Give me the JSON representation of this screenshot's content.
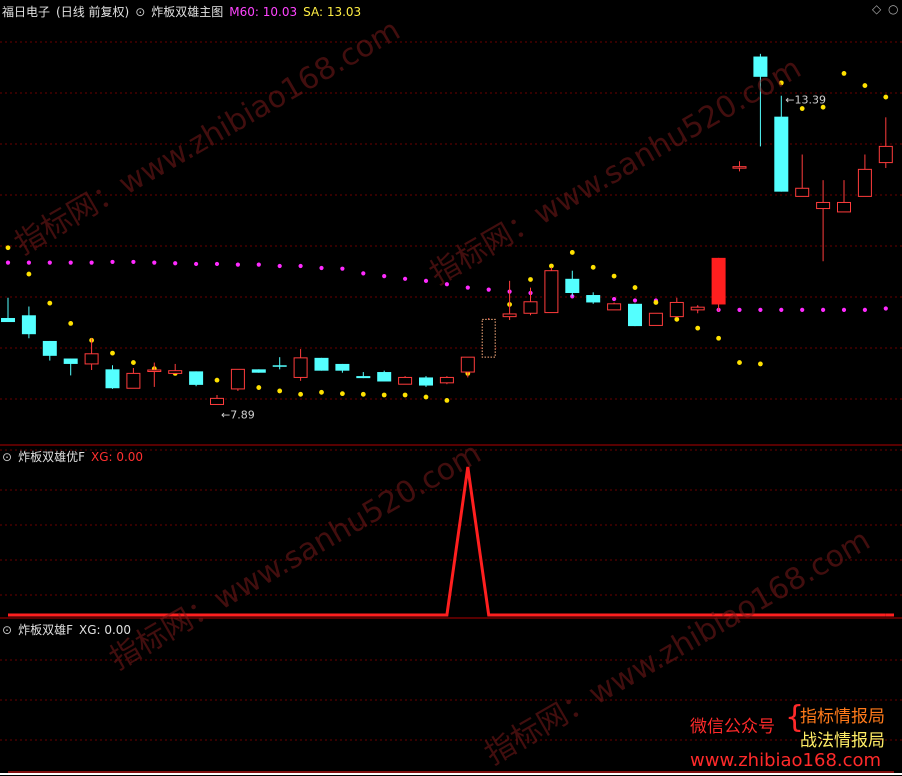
{
  "app": {
    "stock_title": "福日电子",
    "period_label": "(日线 前复权)",
    "indicator_main": "炸板双雄主图",
    "m60_label": "M60: 10.03",
    "sa_label": "SA: 13.03",
    "sub1_title": "炸板双雄优F",
    "sub1_value": "XG: 0.00",
    "sub2_title": "炸板双雄F",
    "sub2_value": "XG: 0.00"
  },
  "icons": {
    "collapse": "circle-chevron-down-icon",
    "panel_toggle": "diamond-icon"
  },
  "colors": {
    "up": "#ff3c3c",
    "down": "#54ffff",
    "m60": "#ff2bff",
    "sa": "#ffe100",
    "signal": "#ff1f1f",
    "grid": "#6a0000",
    "m60_label": "#ff44ff",
    "sa_label": "#ffee44"
  },
  "watermarks": [
    "指标网：www.zhibiao168.com",
    "指标网：www.sanhu520.com",
    "指标网：www.sanhu520.com",
    "指标网：www.zhibiao168.com"
  ],
  "ad": {
    "wechat": "微信公众号",
    "line1": "指标情报局",
    "line2": "战法情报局",
    "url": "www.zhibiao168.com"
  },
  "chart_data": [
    {
      "type": "candlestick",
      "title": "炸板双雄主图",
      "annotations": [
        {
          "text": "13.39",
          "index": 37
        },
        {
          "text": "7.89",
          "index": 10
        }
      ],
      "candles": [
        {
          "o": 9.48,
          "h": 9.78,
          "l": 9.44,
          "c": 9.42,
          "down": true
        },
        {
          "o": 9.52,
          "h": 9.65,
          "l": 9.18,
          "c": 9.24,
          "down": true
        },
        {
          "o": 9.14,
          "h": 9.14,
          "l": 8.85,
          "c": 8.92,
          "down": true
        },
        {
          "o": 8.88,
          "h": 8.88,
          "l": 8.63,
          "c": 8.8,
          "down": true
        },
        {
          "o": 8.8,
          "h": 9.18,
          "l": 8.71,
          "c": 8.95,
          "down": false
        },
        {
          "o": 8.72,
          "h": 8.78,
          "l": 8.43,
          "c": 8.44,
          "down": true
        },
        {
          "o": 8.44,
          "h": 8.74,
          "l": 8.44,
          "c": 8.66,
          "down": false
        },
        {
          "o": 8.7,
          "h": 8.82,
          "l": 8.46,
          "c": 8.71,
          "down": false
        },
        {
          "o": 8.66,
          "h": 8.8,
          "l": 8.66,
          "c": 8.7,
          "down": false
        },
        {
          "o": 8.69,
          "h": 8.69,
          "l": 8.47,
          "c": 8.49,
          "down": true
        },
        {
          "o": 8.2,
          "h": 8.34,
          "l": 8.2,
          "c": 8.29,
          "down": false
        },
        {
          "o": 8.43,
          "h": 8.72,
          "l": 8.4,
          "c": 8.72,
          "down": false
        },
        {
          "o": 8.72,
          "h": 8.72,
          "l": 8.67,
          "c": 8.67,
          "down": true
        },
        {
          "o": 8.78,
          "h": 8.9,
          "l": 8.72,
          "c": 8.78,
          "down": true
        },
        {
          "o": 8.6,
          "h": 9.02,
          "l": 8.55,
          "c": 8.89,
          "down": false
        },
        {
          "o": 8.89,
          "h": 8.89,
          "l": 8.7,
          "c": 8.7,
          "down": true
        },
        {
          "o": 8.8,
          "h": 8.8,
          "l": 8.67,
          "c": 8.7,
          "down": true
        },
        {
          "o": 8.59,
          "h": 8.68,
          "l": 8.59,
          "c": 8.62,
          "down": true
        },
        {
          "o": 8.68,
          "h": 8.7,
          "l": 8.54,
          "c": 8.54,
          "down": true
        },
        {
          "o": 8.5,
          "h": 8.62,
          "l": 8.5,
          "c": 8.6,
          "down": false
        },
        {
          "o": 8.6,
          "h": 8.62,
          "l": 8.46,
          "c": 8.48,
          "down": true
        },
        {
          "o": 8.52,
          "h": 8.62,
          "l": 8.5,
          "c": 8.6,
          "down": false
        },
        {
          "o": 8.68,
          "h": 8.9,
          "l": 8.6,
          "c": 8.9,
          "down": false
        },
        {
          "o": 8.9,
          "h": 9.48,
          "l": 8.9,
          "c": 9.46,
          "down": false,
          "hollow": true
        },
        {
          "o": 9.5,
          "h": 10.03,
          "l": 9.45,
          "c": 9.54,
          "down": false
        },
        {
          "o": 9.55,
          "h": 9.93,
          "l": 9.52,
          "c": 9.72,
          "down": false
        },
        {
          "o": 9.56,
          "h": 10.23,
          "l": 9.56,
          "c": 10.18,
          "down": false
        },
        {
          "o": 10.06,
          "h": 10.18,
          "l": 9.8,
          "c": 9.85,
          "down": true
        },
        {
          "o": 9.82,
          "h": 9.86,
          "l": 9.69,
          "c": 9.71,
          "down": true
        },
        {
          "o": 9.6,
          "h": 9.71,
          "l": 9.6,
          "c": 9.69,
          "down": false
        },
        {
          "o": 9.69,
          "h": 9.69,
          "l": 9.36,
          "c": 9.36,
          "down": true
        },
        {
          "o": 9.37,
          "h": 9.55,
          "l": 9.37,
          "c": 9.55,
          "down": false
        },
        {
          "o": 9.5,
          "h": 9.78,
          "l": 9.5,
          "c": 9.71,
          "down": false
        },
        {
          "o": 9.6,
          "h": 9.67,
          "l": 9.55,
          "c": 9.64,
          "down": false
        },
        {
          "o": 9.68,
          "h": 10.37,
          "l": 9.58,
          "c": 10.37,
          "down": false,
          "solid": true
        },
        {
          "o": 11.72,
          "h": 11.8,
          "l": 11.65,
          "c": 11.72,
          "down": false
        },
        {
          "o": 13.35,
          "h": 13.39,
          "l": 12.02,
          "c": 13.05,
          "down": true
        },
        {
          "o": 12.46,
          "h": 12.77,
          "l": 11.35,
          "c": 11.35,
          "down": true
        },
        {
          "o": 11.4,
          "h": 11.9,
          "l": 11.3,
          "c": 11.28,
          "down": false
        },
        {
          "o": 11.1,
          "h": 11.52,
          "l": 10.32,
          "c": 11.19,
          "down": false
        },
        {
          "o": 11.05,
          "h": 11.52,
          "l": 11.05,
          "c": 11.19,
          "down": false
        },
        {
          "o": 11.28,
          "h": 11.9,
          "l": 11.28,
          "c": 11.68,
          "down": false
        },
        {
          "o": 11.78,
          "h": 12.45,
          "l": 11.7,
          "c": 12.02,
          "down": false
        }
      ],
      "series": [
        {
          "name": "M60",
          "values": [
            10.3,
            10.3,
            10.3,
            10.3,
            10.3,
            10.31,
            10.31,
            10.3,
            10.29,
            10.28,
            10.28,
            10.27,
            10.27,
            10.25,
            10.25,
            10.22,
            10.21,
            10.14,
            10.1,
            10.06,
            10.03,
            9.98,
            9.93,
            9.9,
            9.87,
            9.85,
            9.82,
            9.8,
            9.78,
            9.76,
            9.74,
            9.74,
            9.68,
            9.62,
            9.6,
            9.6,
            9.6,
            9.6,
            9.6,
            9.6,
            9.6,
            9.6,
            9.62,
            9.62,
            9.62,
            9.63
          ]
        },
        {
          "name": "SA",
          "values": [
            10.52,
            10.13,
            9.7,
            9.4,
            9.15,
            8.96,
            8.82,
            8.73,
            8.66,
            8.6,
            8.56,
            8.49,
            8.45,
            8.4,
            8.35,
            8.38,
            8.36,
            8.35,
            8.34,
            8.34,
            8.31,
            8.26,
            8.66,
            9.05,
            9.68,
            10.05,
            10.25,
            10.45,
            10.23,
            10.1,
            9.93,
            9.71,
            9.46,
            9.33,
            9.18,
            8.82,
            8.8,
            12.96,
            12.58,
            12.6,
            13.1,
            12.92,
            12.75,
            12.67,
            12.55,
            12.42
          ]
        },
        {
          "name": "XG",
          "subchart": 1,
          "values": [
            0,
            0,
            0,
            0,
            0,
            0,
            0,
            0,
            0,
            0,
            0,
            0,
            0,
            0,
            0,
            0,
            0,
            0,
            0,
            0,
            0,
            0,
            1,
            0,
            0,
            0,
            0,
            0,
            0,
            0,
            0,
            0,
            0,
            0,
            0,
            0,
            0,
            0,
            0,
            0,
            0,
            0,
            0
          ]
        },
        {
          "name": "XG",
          "subchart": 2,
          "values": [
            0,
            0,
            0,
            0,
            0,
            0,
            0,
            0,
            0,
            0,
            0,
            0,
            0,
            0,
            0,
            0,
            0,
            0,
            0,
            0,
            0,
            0,
            0,
            0,
            0,
            0,
            0,
            0,
            0,
            0,
            0,
            0,
            0,
            0,
            0,
            0,
            0,
            0,
            0,
            0,
            0,
            0,
            0
          ]
        }
      ],
      "ylim": [
        7.6,
        13.95
      ]
    }
  ]
}
